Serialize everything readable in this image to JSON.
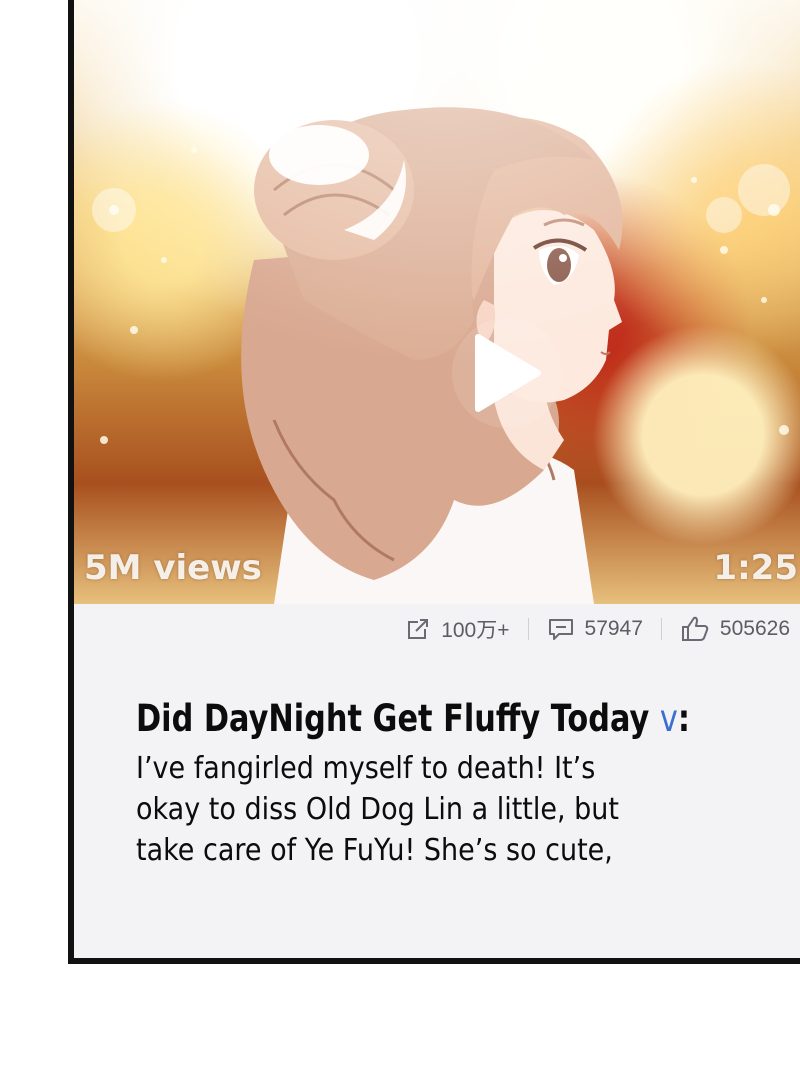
{
  "video": {
    "views_label": "5M views",
    "duration": "1:25",
    "play_icon": "play-icon"
  },
  "stats": {
    "shares": "100万+",
    "comments": "57947",
    "likes": "505626",
    "icons": [
      "share-icon",
      "comment-icon",
      "thumbs-up-icon"
    ]
  },
  "comment": {
    "author": "Did DayNight Get Fluffy Today",
    "verified_mark": "v",
    "separator": ":",
    "lines": [
      "I’ve fangirled myself to death! It’s",
      "okay to diss Old Dog Lin a little, but",
      "take care of Ye FuYu! She’s so cute,"
    ]
  },
  "colors": {
    "verified": "#3b6ed1",
    "border": "#111111",
    "card_bg": "#f3f2f4"
  }
}
